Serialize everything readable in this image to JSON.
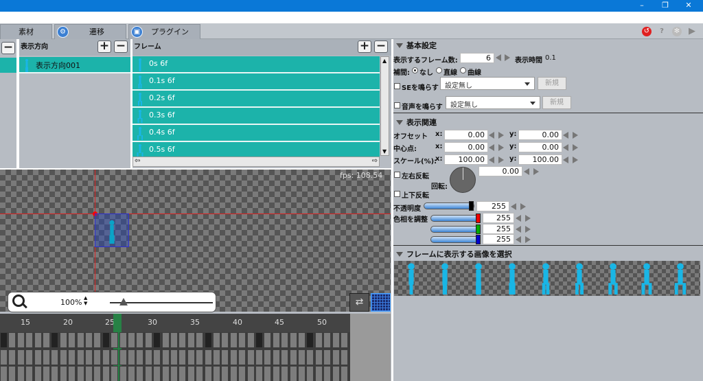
{
  "window": {
    "minimize": "–",
    "restore": "❐",
    "close": "✕"
  },
  "tabs": [
    {
      "label": "素材"
    },
    {
      "label": "遷移",
      "icon": "plugin-link-icon"
    },
    {
      "label": "プラグイン",
      "icon": "plugin-box-icon"
    }
  ],
  "toolbar_icons": [
    "record-icon",
    "help-icon",
    "settings-icon",
    "play-icon"
  ],
  "direction_panel": {
    "title": "表示方向",
    "items": [
      "表示方向001"
    ]
  },
  "frame_panel": {
    "title": "フレーム",
    "frames": [
      "0s 6f",
      "0.1s 6f",
      "0.2s 6f",
      "0.3s 6f",
      "0.4s 6f",
      "0.5s 6f"
    ]
  },
  "canvas": {
    "fps": "fps: 108.54"
  },
  "zoom": {
    "value": "100%"
  },
  "timeline": {
    "ticks": [
      "15",
      "20",
      "25",
      "30",
      "35",
      "40",
      "45",
      "50"
    ]
  },
  "basic": {
    "section_title": "基本設定",
    "frame_count_label": "表示するフレーム数:",
    "frame_count": "6",
    "display_time_label": "表示時間",
    "display_time": "0.1",
    "interp_label": "補間:",
    "interp_options": [
      "なし",
      "直線",
      "曲線"
    ],
    "se_label": "SEを鳴らす",
    "se_value": "設定無し",
    "se_new": "新規",
    "voice_label": "音声を鳴らす",
    "voice_value": "設定無し",
    "voice_new": "新規"
  },
  "display": {
    "section_title": "表示関連",
    "offset_label": "オフセット",
    "center_label": "中心点:",
    "scale_label": "スケール(%):",
    "x_label": "x:",
    "y_label": "y:",
    "offset_x": "0.00",
    "offset_y": "0.00",
    "center_x": "0.00",
    "center_y": "0.00",
    "scale_x": "100.00",
    "scale_y": "100.00",
    "flip_h_label": "左右反転",
    "flip_v_label": "上下反転",
    "rotation_label": "回転:",
    "rotation": "0.00",
    "opacity_label": "不透明度",
    "opacity": "255",
    "hue_label": "色相を調整",
    "red": "255",
    "green": "255",
    "blue": "255"
  },
  "frame_images": {
    "section_title": "フレームに表示する画像を選択",
    "count": 9
  },
  "colors": {
    "accent": "#0a78d7",
    "teal": "#1cb3aa",
    "figure": "#19b6e6"
  }
}
